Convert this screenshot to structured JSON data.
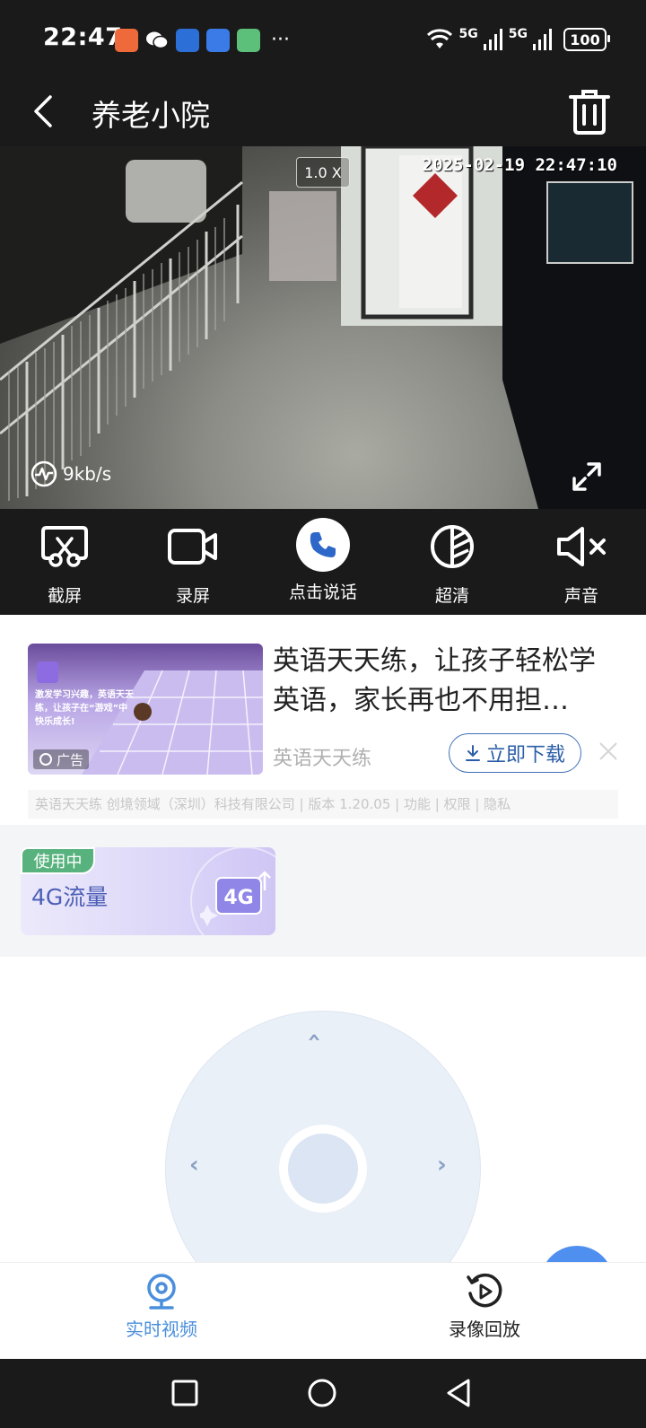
{
  "status_bar": {
    "time": "22:47",
    "more": "···",
    "signal1": "5G",
    "signal2": "5G",
    "battery": "100"
  },
  "header": {
    "title": "养老小院",
    "back_icon": "chevron-left-icon",
    "delete_icon": "trash-icon"
  },
  "video": {
    "zoom": "1.0 X",
    "timestamp": "2025-02-19 22:47:10",
    "bitrate": "9kb/s"
  },
  "controls": [
    {
      "label": "截屏",
      "icon": "screenshot-icon"
    },
    {
      "label": "录屏",
      "icon": "video-camera-icon"
    },
    {
      "label": "点击说话",
      "icon": "phone-icon"
    },
    {
      "label": "超清",
      "icon": "hd-quality-icon"
    },
    {
      "label": "声音",
      "icon": "speaker-mute-icon"
    }
  ],
  "ad": {
    "title": "英语天天练，让孩子轻松学英语，家长再也不用担…",
    "brand": "英语天天练",
    "download": "立即下载",
    "ad_tag": "广告",
    "info": "英语天天练 创境领域（深圳）科技有限公司 | 版本 1.20.05 | 功能 | 权限 | 隐私",
    "image_app_name": "英语天天练",
    "image_caption": "激发学习兴趣，英语天天练，让孩子在“游戏”中快乐成长!"
  },
  "data_card": {
    "badge": "使用中",
    "label": "4G流量",
    "icon_text": "4G"
  },
  "ptz": {
    "up": "‹",
    "left": "‹",
    "right": "›"
  },
  "tabs": [
    {
      "label": "实时视频",
      "icon": "camera-icon",
      "active": true
    },
    {
      "label": "录像回放",
      "icon": "playback-icon",
      "active": false
    }
  ],
  "colors": {
    "dark_bg": "#1a1a1a",
    "active_tab": "#4a8fdc",
    "accent_blue": "#2b5ea8",
    "in_use_green": "#58b27e"
  }
}
